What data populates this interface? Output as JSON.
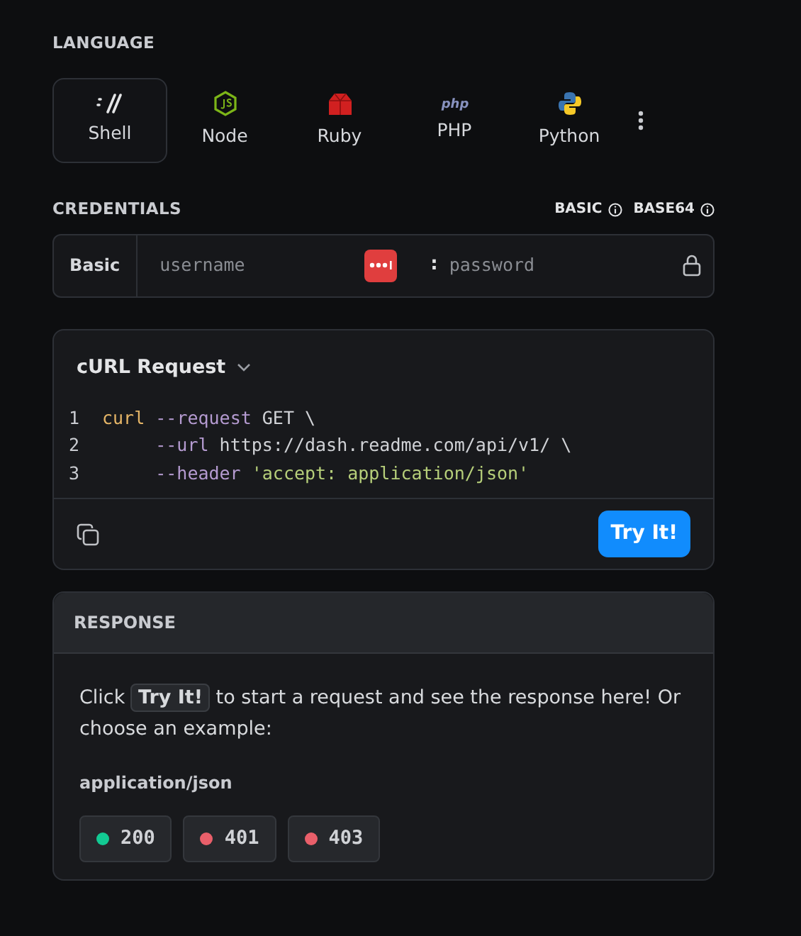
{
  "language": {
    "heading": "LANGUAGE",
    "tabs": [
      {
        "label": "Shell",
        "kind": "shell",
        "selected": true
      },
      {
        "label": "Node",
        "kind": "node",
        "selected": false
      },
      {
        "label": "Ruby",
        "kind": "ruby",
        "selected": false
      },
      {
        "label": "PHP",
        "kind": "php",
        "selected": false
      },
      {
        "label": "Python",
        "kind": "python",
        "selected": false
      }
    ]
  },
  "credentials": {
    "heading": "CREDENTIALS",
    "links": [
      "BASIC",
      "BASE64"
    ],
    "scheme": "Basic",
    "username": {
      "placeholder": "username"
    },
    "separator": ":",
    "password": {
      "placeholder": "password"
    }
  },
  "request": {
    "title": "cURL Request",
    "lines": [
      {
        "number": "1",
        "indented": false,
        "tokens": [
          {
            "kind": "command",
            "text": "curl"
          },
          {
            "kind": "flag",
            "text": "--request"
          },
          {
            "kind": "plain",
            "text": "GET \\"
          }
        ]
      },
      {
        "number": "2",
        "indented": true,
        "tokens": [
          {
            "kind": "flag",
            "text": "--url"
          },
          {
            "kind": "plain",
            "text": "https://dash.readme.com/api/v1/ \\"
          }
        ]
      },
      {
        "number": "3",
        "indented": true,
        "tokens": [
          {
            "kind": "flag",
            "text": "--header"
          },
          {
            "kind": "string",
            "text": "'accept: application/json'"
          }
        ]
      }
    ],
    "button": "Try It!"
  },
  "response": {
    "heading": "RESPONSE",
    "hint": {
      "before": "Click",
      "chip": "Try It!",
      "after": "to start a request and see the response here! Or choose an example:"
    },
    "media_type": "application/json",
    "examples": [
      {
        "code": "200",
        "color": "#12ca93"
      },
      {
        "code": "401",
        "color": "#e95f6a"
      },
      {
        "code": "403",
        "color": "#e95f6a"
      }
    ]
  }
}
